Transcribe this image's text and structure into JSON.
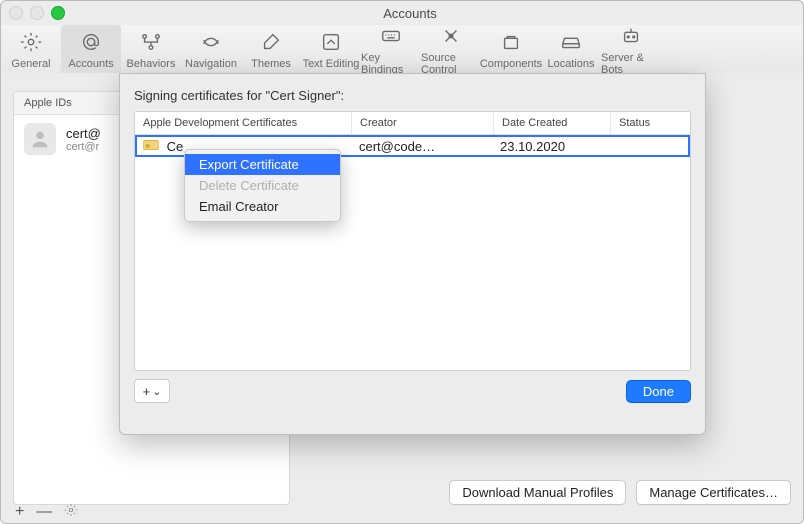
{
  "window": {
    "title": "Accounts"
  },
  "toolbar": {
    "items": [
      {
        "label": "General"
      },
      {
        "label": "Accounts"
      },
      {
        "label": "Behaviors"
      },
      {
        "label": "Navigation"
      },
      {
        "label": "Themes"
      },
      {
        "label": "Text Editing"
      },
      {
        "label": "Key Bindings"
      },
      {
        "label": "Source Control"
      },
      {
        "label": "Components"
      },
      {
        "label": "Locations"
      },
      {
        "label": "Server & Bots"
      }
    ]
  },
  "sidebar": {
    "header": "Apple IDs",
    "account": {
      "line1": "cert@",
      "line2": "cert@r"
    }
  },
  "buttons": {
    "download": "Download Manual Profiles",
    "manage": "Manage Certificates…"
  },
  "footer": {
    "plus": "+",
    "minus": "—"
  },
  "sheet": {
    "title": "Signing certificates for \"Cert Signer\":",
    "columns": {
      "c1": "Apple Development Certificates",
      "c2": "Creator",
      "c3": "Date Created",
      "c4": "Status"
    },
    "row": {
      "name_visible": "Ce",
      "creator": "cert@code…",
      "date": "23.10.2020",
      "status": ""
    },
    "add_symbol": "+",
    "add_chevron": "⌄",
    "done": "Done"
  },
  "context_menu": {
    "items": [
      {
        "label": "Export Certificate",
        "state": "highlighted"
      },
      {
        "label": "Delete Certificate",
        "state": "disabled"
      },
      {
        "label": "Email Creator",
        "state": "normal"
      }
    ]
  }
}
